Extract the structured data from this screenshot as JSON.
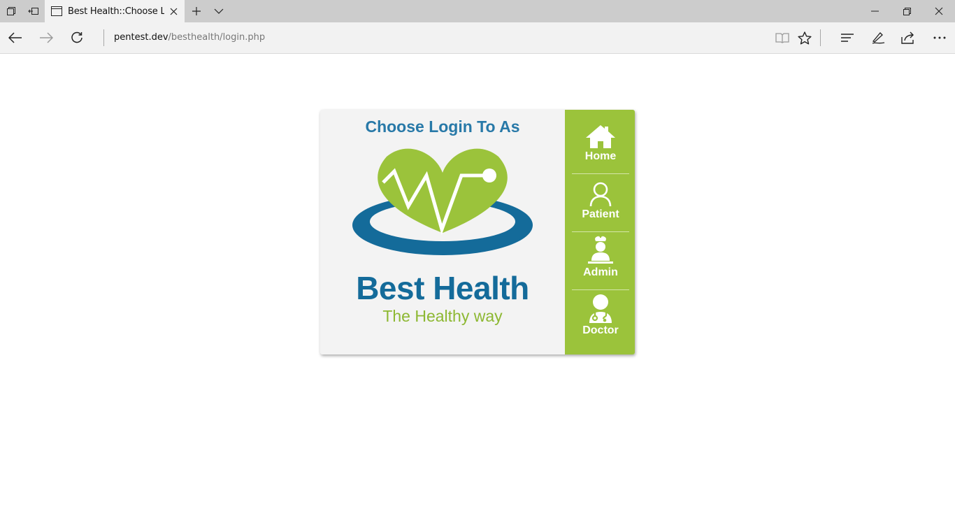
{
  "browser": {
    "tab_title": "Best Health::Choose Log",
    "address_host": "pentest.dev",
    "address_path": "/besthealth/login.php"
  },
  "page": {
    "heading": "Choose Login To As",
    "brand": "Best Health",
    "tagline": "The Healthy way",
    "menu": [
      {
        "label": "Home",
        "icon": "home-icon"
      },
      {
        "label": "Patient",
        "icon": "patient-icon"
      },
      {
        "label": "Admin",
        "icon": "nurse-icon"
      },
      {
        "label": "Doctor",
        "icon": "doctor-icon"
      }
    ]
  },
  "colors": {
    "heading": "#2879a8",
    "brand": "#146b9a",
    "accent_green": "#9bc33b",
    "tagline": "#8db832"
  }
}
